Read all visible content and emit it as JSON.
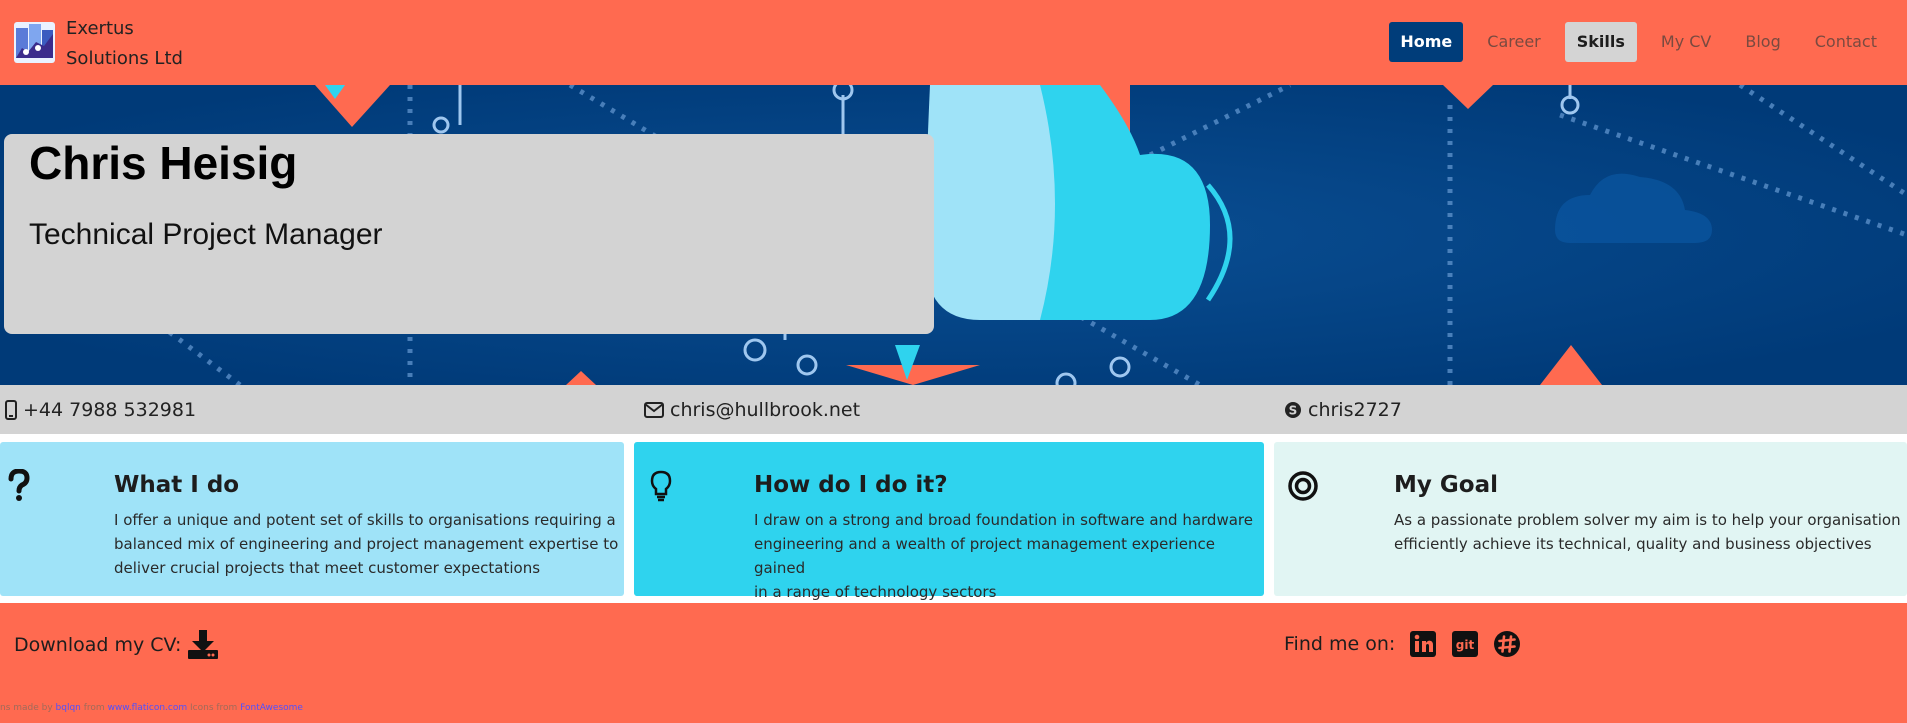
{
  "header": {
    "brand_line1": "Exertus",
    "brand_line2": "Solutions Ltd",
    "nav": [
      "Home",
      "Career",
      "Skills",
      "My CV",
      "Blog",
      "Contact"
    ],
    "active": "Home",
    "hovered": "Skills"
  },
  "hero": {
    "name": "Chris Heisig",
    "title": "Technical Project Manager"
  },
  "contact": {
    "phone": "+44 7988 532981",
    "email": "chris@hullbrook.net",
    "skype": "chris2727"
  },
  "cards": [
    {
      "icon": "question-icon",
      "heading": "What I do",
      "text_lines": [
        "I offer a unique and potent set of skills to organisations requiring a",
        "balanced mix of engineering and project management expertise to",
        "deliver crucial projects that meet customer expectations"
      ]
    },
    {
      "icon": "lightbulb-icon",
      "heading": "How do I do it?",
      "text_lines": [
        "I draw on a strong and broad foundation in software and hardware",
        "engineering and a wealth of project management experience gained",
        "in a range of technology sectors"
      ]
    },
    {
      "icon": "target-icon",
      "heading": "My Goal",
      "text_lines": [
        "As a passionate problem solver my aim is to help your organisation",
        "efficiently achieve its technical, quality and business objectives"
      ]
    }
  ],
  "footer": {
    "download_label": "Download my CV:",
    "find_label": "Find me on:",
    "social": [
      "linkedin-icon",
      "git-icon",
      "slack-icon"
    ],
    "credits": {
      "t1": "ns made by ",
      "l1": "bqlqn",
      "t2": " from ",
      "l2": "www.flaticon.com",
      "t3": " Icons from ",
      "l3": "FontAwesome"
    }
  },
  "colors": {
    "header_bg": "#ff6a50",
    "hero_bg": "#004080",
    "nav_active": "#003d7a",
    "card1": "#9fe3f8",
    "card2": "#2fd3ee",
    "card3": "#e1f5f3",
    "strip": "#d3d3d3"
  }
}
